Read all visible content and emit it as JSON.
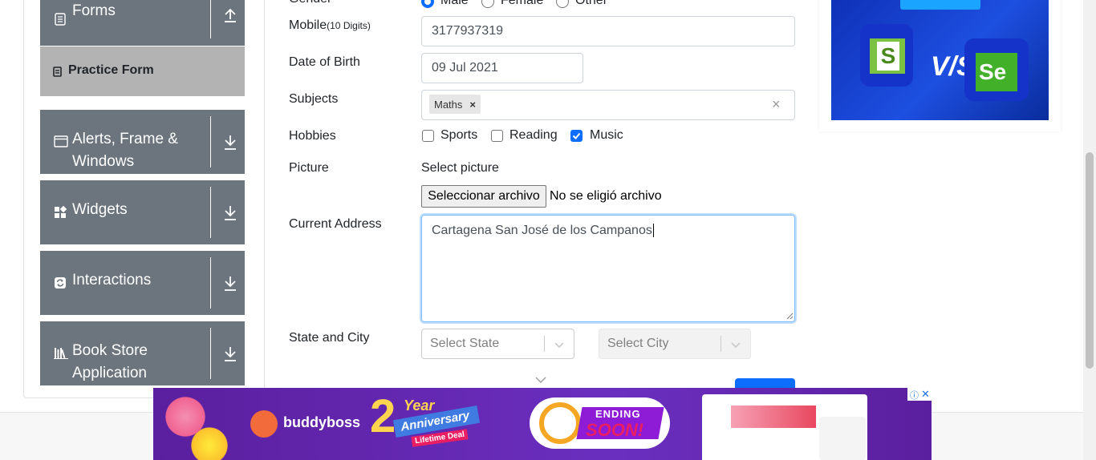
{
  "sidebar": {
    "groups": [
      {
        "label_line1": "Forms",
        "label_line2": "",
        "icon": "document-icon",
        "toggle": "arrow-up-icon"
      },
      {
        "label_line1": "Alerts, Frame &",
        "label_line2": "Windows",
        "icon": "window-icon",
        "toggle": "arrow-down-icon"
      },
      {
        "label_line1": "Widgets",
        "label_line2": "",
        "icon": "grid-icon",
        "toggle": "arrow-down-icon"
      },
      {
        "label_line1": "Interactions",
        "label_line2": "",
        "icon": "refresh-icon",
        "toggle": "arrow-down-icon"
      },
      {
        "label_line1": "Book Store",
        "label_line2": "Application",
        "icon": "books-icon",
        "toggle": "arrow-down-icon"
      }
    ],
    "active_item": "Practice Form"
  },
  "form": {
    "gender": {
      "label": "Gender",
      "options": [
        "Male",
        "Female",
        "Other"
      ],
      "selected": "Male"
    },
    "mobile": {
      "label": "Mobile",
      "hint": "(10 Digits)",
      "value": "3177937319"
    },
    "dob": {
      "label": "Date of Birth",
      "value": "09 Jul 2021"
    },
    "subjects": {
      "label": "Subjects",
      "chips": [
        "Maths"
      ],
      "chip_remove": "×",
      "clear": "×"
    },
    "hobbies": {
      "label": "Hobbies",
      "options": [
        "Sports",
        "Reading",
        "Music"
      ],
      "checked": [
        "Music"
      ]
    },
    "picture": {
      "label": "Picture",
      "prompt": "Select picture",
      "button": "Seleccionar archivo",
      "status": "No se eligió archivo"
    },
    "address": {
      "label": "Current Address",
      "value": "Cartagena San José de los Campanos"
    },
    "state_city": {
      "label": "State and City",
      "state_placeholder": "Select State",
      "city_placeholder": "Select City"
    }
  },
  "ads": {
    "top": {
      "vs_text": "V/S",
      "left_logo": "S",
      "right_logo": "Se"
    },
    "bottom": {
      "brand": "buddyboss",
      "anniversary_year": "2",
      "anniversary_word": "Year",
      "anniversary_title": "Anniversary",
      "deal": "Lifetime Deal",
      "ending": "ENDING",
      "soon": "SOON!"
    }
  },
  "colors": {
    "nav_header": "#6c757d",
    "nav_active": "#b3b3b3",
    "primary": "#0d6efd",
    "ad_purple": "#5a1f9e"
  }
}
